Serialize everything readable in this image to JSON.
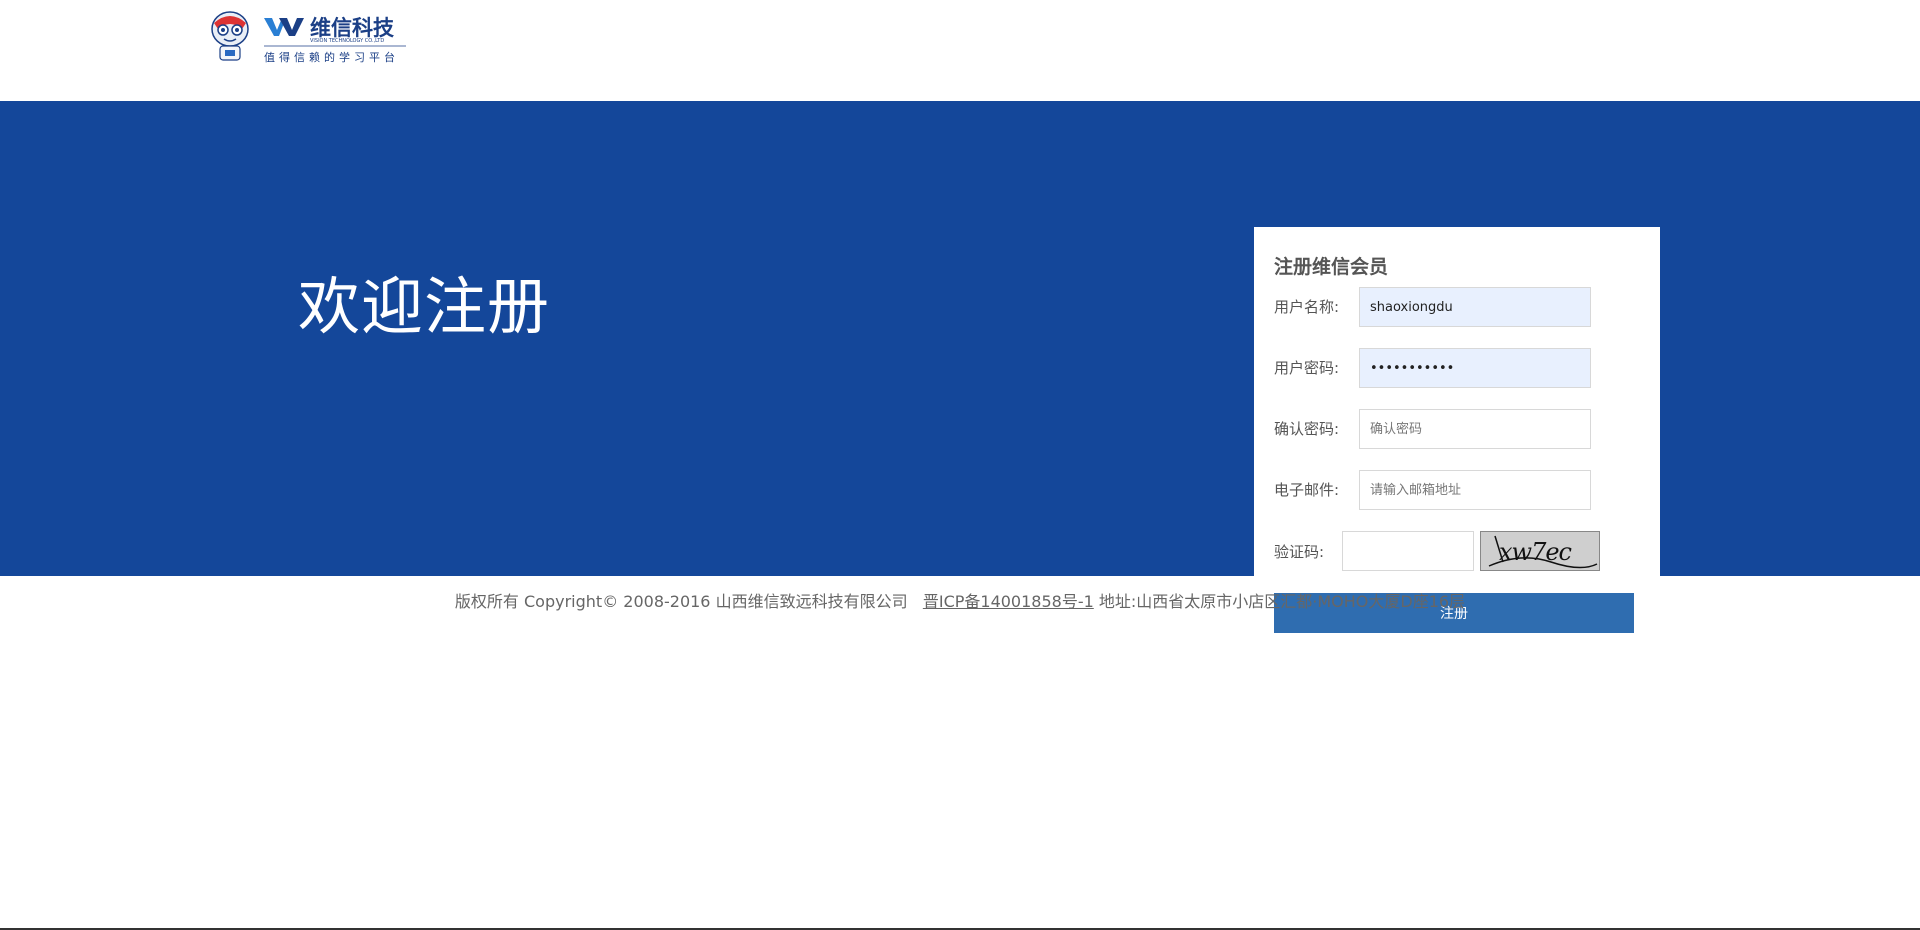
{
  "header": {
    "logo": {
      "brand_cn": "维信科技",
      "brand_en": "VISION TECHNOLOGY CO.,LTD",
      "slogan": "值得信赖的学习平台"
    }
  },
  "banner": {
    "welcome_text": "欢迎注册"
  },
  "form": {
    "title": "注册维信会员",
    "username": {
      "label": "用户名称:",
      "value": "shaoxiongdu",
      "placeholder": ""
    },
    "password": {
      "label": "用户密码:",
      "value": "•••••••••••",
      "placeholder": ""
    },
    "confirm_password": {
      "label": "确认密码:",
      "value": "",
      "placeholder": "确认密码"
    },
    "email": {
      "label": "电子邮件:",
      "value": "",
      "placeholder": "请输入邮箱地址"
    },
    "captcha": {
      "label": "验证码:",
      "value": "",
      "image_text": "xw7ec"
    },
    "submit_label": "注册"
  },
  "footer": {
    "copyright": "版权所有 Copyright© 2008-2016 山西维信致远科技有限公司",
    "icp_link": "晋ICP备14001858号-1",
    "address": "地址:山西省太原市小店区汇都·MOHO大厦D座16层"
  },
  "colors": {
    "banner": "#14479a",
    "button": "#2f6db0",
    "autofill": "#e8f0fe"
  }
}
